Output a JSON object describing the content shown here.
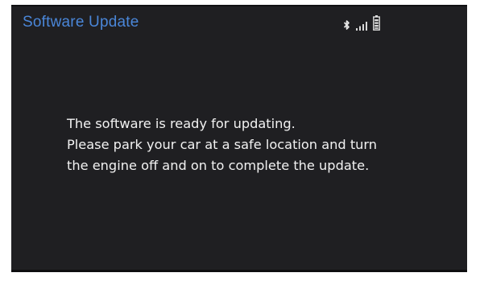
{
  "header": {
    "title": "Software Update",
    "status_icons": [
      "bluetooth-icon",
      "signal-strength-icon",
      "battery-icon"
    ]
  },
  "message": {
    "lines": [
      "The software is ready for updating.",
      "Please park your car at a safe location and turn",
      "the engine off and on to complete the update."
    ]
  },
  "colors": {
    "background": "#1f1f22",
    "title": "#4a86d8",
    "text": "#f2f2f2"
  }
}
